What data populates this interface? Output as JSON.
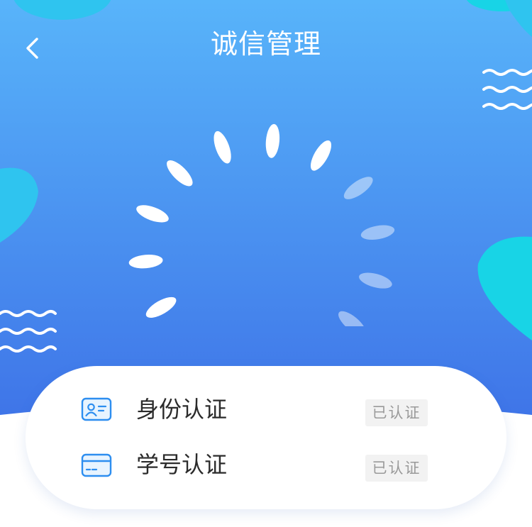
{
  "header": {
    "title": "诚信管理",
    "back_icon": "chevron-left-icon"
  },
  "theme": {
    "gradient_top": "#58b4fa",
    "gradient_bottom": "#3f75e8",
    "blob_color": "#2fc4ef",
    "blob_accent": "#18d4e6",
    "badge_text_color": "#9a9a9a",
    "badge_bg": "#f2f2f2"
  },
  "score_indicator": {
    "total_segments": 13,
    "highlighted_segments": 9
  },
  "certifications": [
    {
      "label": "身份认证",
      "status": "已认证",
      "icon": "id-card-icon"
    },
    {
      "label": "学号认证",
      "status": "已认证",
      "icon": "student-card-icon"
    }
  ]
}
